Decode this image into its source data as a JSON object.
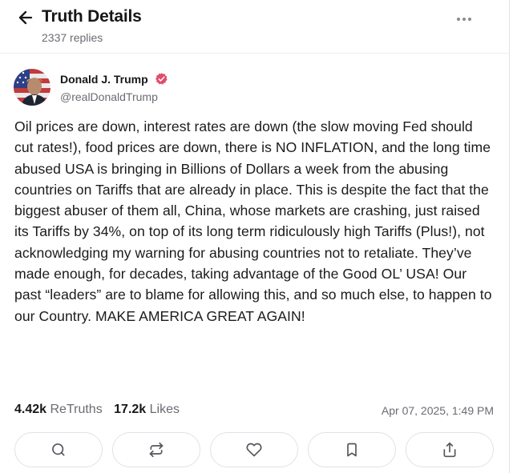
{
  "header": {
    "title": "Truth Details",
    "subtitle": "2337 replies",
    "back_icon": "arrow-left-icon",
    "more_icon": "more-horizontal-icon"
  },
  "post": {
    "author": "Donald J. Trump",
    "handle": "@realDonaldTrump",
    "verified_color": "#e14d6b",
    "text": "Oil prices are down, interest rates are down (the slow moving Fed should cut rates!), food prices are down, there is NO INFLATION, and the long time abused USA is bringing in Billions of Dollars a week from the abusing countries on Tariffs that are already in place. This is despite the fact that the biggest abuser of them all, China, whose markets are crashing, just raised its Tariffs by 34%, on top of its long term ridiculously high Tariffs (Plus!), not acknowledging my warning for abusing countries not to retaliate. They’ve made enough, for decades, taking advantage of the Good OL’ USA! Our past “leaders” are to blame for allowing this, and so much else, to happen to our Country. MAKE AMERICA GREAT AGAIN!",
    "retruths_count": "4.42k",
    "retruths_label": "ReTruths",
    "likes_count": "17.2k",
    "likes_label": "Likes",
    "timestamp": "Apr 07, 2025, 1:49 PM"
  },
  "actions": [
    {
      "name": "reply",
      "icon": "comment-icon"
    },
    {
      "name": "retruth",
      "icon": "repost-icon"
    },
    {
      "name": "like",
      "icon": "heart-icon"
    },
    {
      "name": "bookmark",
      "icon": "bookmark-icon"
    },
    {
      "name": "share",
      "icon": "share-icon"
    }
  ]
}
